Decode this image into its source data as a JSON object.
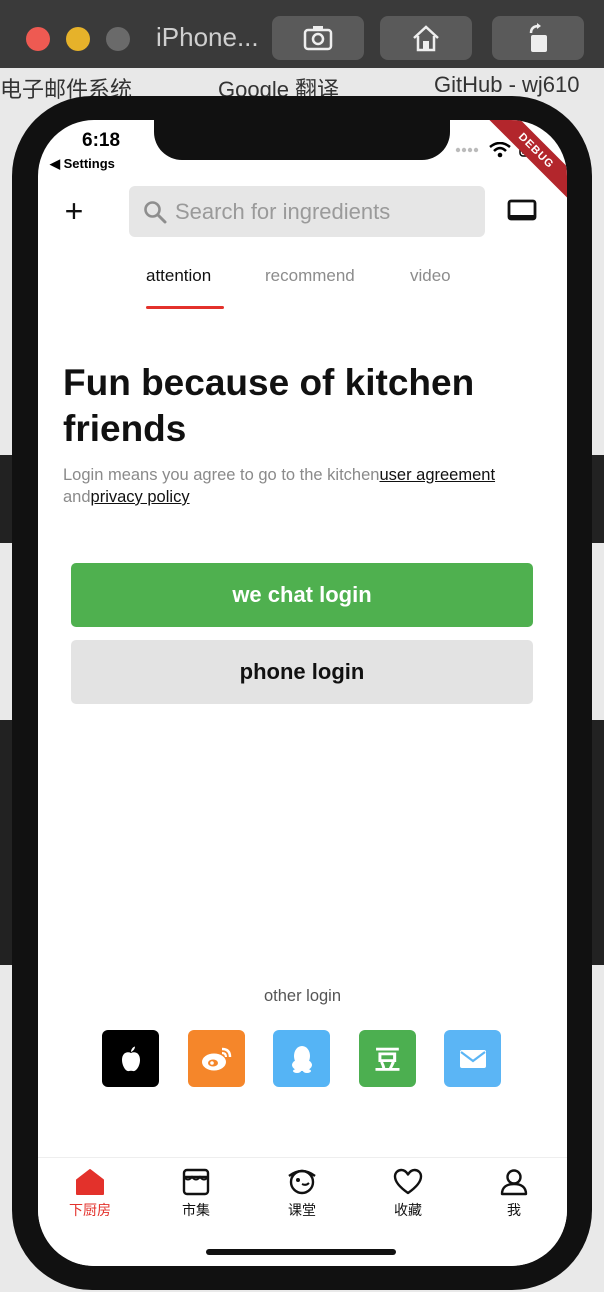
{
  "simulator": {
    "title": "iPhone...",
    "browser_tabs": [
      "电子邮件系统",
      "Google 翻译",
      "GitHub - wj610"
    ]
  },
  "status_bar": {
    "time": "6:18",
    "back_label": "◀ Settings",
    "debug_label": "DEBUG"
  },
  "header": {
    "add_icon": "+",
    "search_placeholder": "Search for ingredients"
  },
  "tabs": [
    {
      "label": "attention",
      "active": true
    },
    {
      "label": "recommend",
      "active": false
    },
    {
      "label": "video",
      "active": false
    }
  ],
  "login": {
    "headline": "Fun because of kitchen friends",
    "agreement_prefix": "Login means you agree to go to the kitchen",
    "user_agreement": "user agreement",
    "and_text": "and",
    "privacy_policy": "privacy policy",
    "wechat_button": "we chat login",
    "phone_button": "phone login",
    "other_login": "other login"
  },
  "social_logins": [
    {
      "name": "apple",
      "color": "#000000",
      "glyph": ""
    },
    {
      "name": "weibo",
      "color": "#f5862a",
      "glyph": ""
    },
    {
      "name": "qq",
      "color": "#55b4f5",
      "glyph": ""
    },
    {
      "name": "douban",
      "color": "#4caf50",
      "glyph": "豆"
    },
    {
      "name": "mail",
      "color": "#5bb5f5",
      "glyph": ""
    }
  ],
  "bottom_nav": [
    {
      "label": "下厨房",
      "icon": "home-icon",
      "active": true
    },
    {
      "label": "市集",
      "icon": "market-icon",
      "active": false
    },
    {
      "label": "课堂",
      "icon": "classroom-icon",
      "active": false
    },
    {
      "label": "收藏",
      "icon": "heart-icon",
      "active": false
    },
    {
      "label": "我",
      "icon": "person-icon",
      "active": false
    }
  ],
  "colors": {
    "accent_red": "#e3312b",
    "wechat_green": "#4fb04f",
    "search_bg": "#e6e6e6",
    "secondary_button_bg": "#e3e3e3"
  }
}
